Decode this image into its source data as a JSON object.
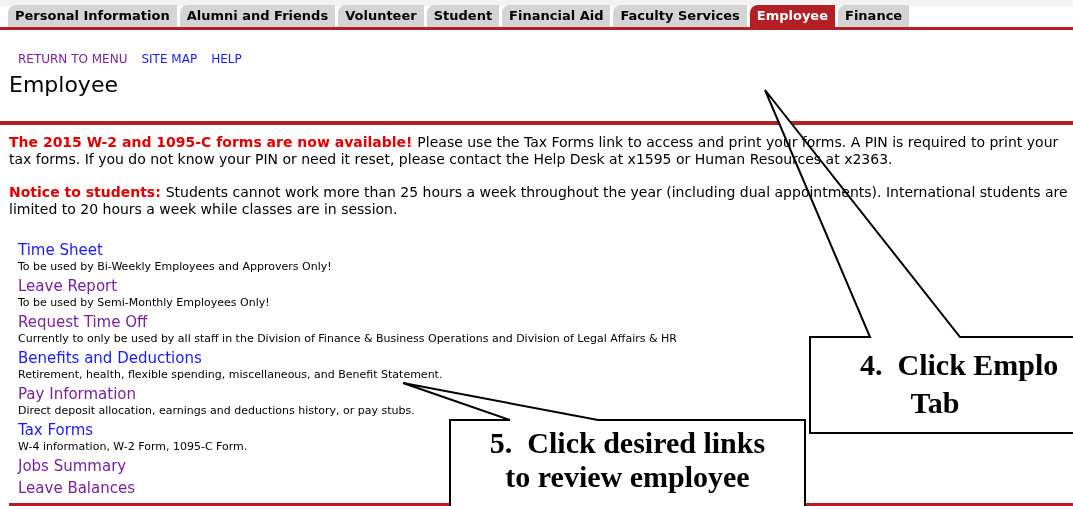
{
  "tabs": [
    {
      "label": "Personal Information",
      "selected": false
    },
    {
      "label": "Alumni and Friends",
      "selected": false
    },
    {
      "label": "Volunteer",
      "selected": false
    },
    {
      "label": "Student",
      "selected": false
    },
    {
      "label": "Financial Aid",
      "selected": false
    },
    {
      "label": "Faculty Services",
      "selected": false
    },
    {
      "label": "Employee",
      "selected": true
    },
    {
      "label": "Finance",
      "selected": false
    }
  ],
  "nav_links": [
    {
      "label": "RETURN TO MENU",
      "visited": true
    },
    {
      "label": "SITE MAP",
      "visited": false
    },
    {
      "label": "HELP",
      "visited": false
    }
  ],
  "page_title": "Employee",
  "notices": [
    {
      "heading": "The 2015 W-2 and 1095-C forms are now available!",
      "lines": [
        "Please use the Tax Forms link to access and print your forms. A PIN is required to print your",
        "tax forms. If you do not know your PIN or need it reset, please contact the Help Desk at x1595 or Human Resources at x2363."
      ]
    },
    {
      "heading": "Notice to students:",
      "lines": [
        "Students cannot work more than 25 hours a week throughout the year (including dual appointments). International students are",
        "limited to 20 hours a week while classes are in session."
      ]
    }
  ],
  "menu": [
    {
      "label": "Time Sheet",
      "visited": false,
      "description": "To be used by Bi-Weekly Employees and Approvers Only!"
    },
    {
      "label": "Leave Report",
      "visited": true,
      "description": "To be used by Semi-Monthly Employees Only!"
    },
    {
      "label": "Request Time Off",
      "visited": true,
      "description": "Currently to only be used by all staff in the Division of Finance & Business Operations and Division of Legal Affairs & HR"
    },
    {
      "label": "Benefits and Deductions",
      "visited": false,
      "description": "Retirement, health, flexible spending, miscellaneous, and Benefit Statement."
    },
    {
      "label": "Pay Information",
      "visited": true,
      "description": "Direct deposit allocation, earnings and deductions history, or pay stubs."
    },
    {
      "label": "Tax Forms",
      "visited": false,
      "description": "W-4 information, W-2 Form, 1095-C Form."
    },
    {
      "label": "Jobs Summary",
      "visited": true
    },
    {
      "label": "Leave Balances",
      "visited": true
    }
  ],
  "callouts": [
    {
      "lines": [
        "4.  Click Emplo",
        "Tab"
      ]
    },
    {
      "lines": [
        "5.  Click desired links",
        "to review employee"
      ]
    }
  ]
}
